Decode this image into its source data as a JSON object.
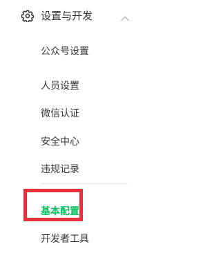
{
  "section": {
    "title": "设置与开发",
    "icon": "gear-icon",
    "toggle_icon": "chevron-up-icon"
  },
  "menu": {
    "items": [
      {
        "label": "公众号设置"
      },
      {
        "label": "人员设置"
      },
      {
        "label": "微信认证"
      },
      {
        "label": "安全中心"
      },
      {
        "label": "违规记录"
      },
      {
        "label": "基本配置",
        "active": true
      },
      {
        "label": "开发者工具"
      }
    ]
  },
  "colors": {
    "text": "#353535",
    "active_text": "#07c160",
    "highlight_border": "#e8303a",
    "divider": "#e7e7eb"
  }
}
